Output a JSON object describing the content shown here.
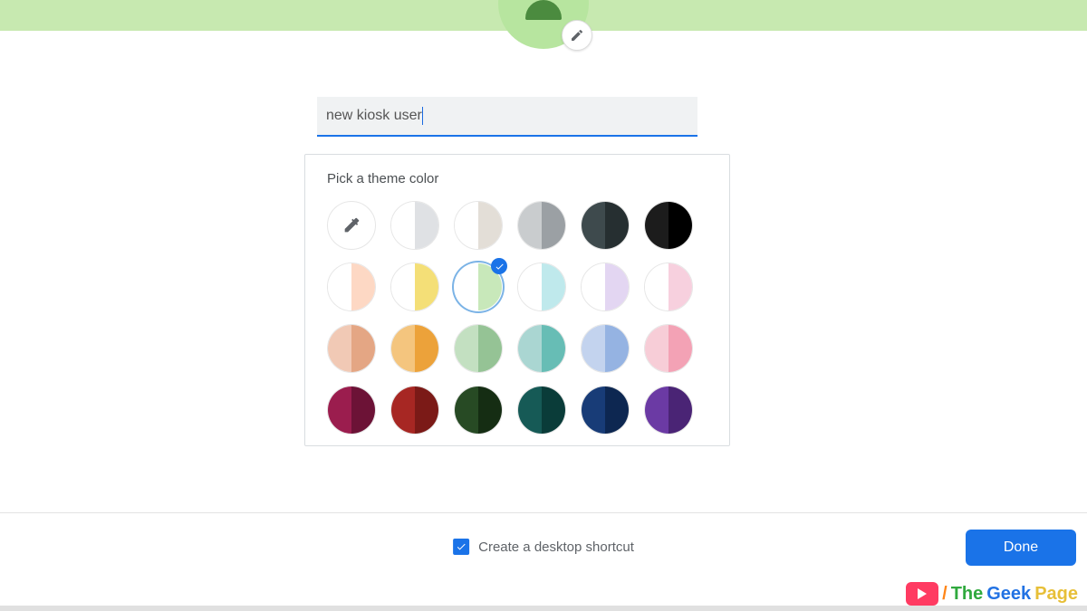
{
  "profile": {
    "name_value": "new kiosk user",
    "avatar_icon": "person-icon"
  },
  "theme_picker": {
    "title": "Pick a theme color",
    "selected_index": 8,
    "swatches": [
      {
        "kind": "eyedropper",
        "name": "custom-color",
        "left": "#ffffff",
        "right": "#ffffff"
      },
      {
        "name": "light-grey",
        "left": "#ffffff",
        "right": "#dfe1e4"
      },
      {
        "name": "warm-grey",
        "left": "#ffffff",
        "right": "#e3ded7"
      },
      {
        "name": "grey",
        "left": "#c9ccce",
        "right": "#9ba0a4"
      },
      {
        "name": "dark-slate",
        "left": "#3e4a4d",
        "right": "#262f31"
      },
      {
        "name": "black",
        "left": "#1c1c1c",
        "right": "#000000"
      },
      {
        "name": "peach-pastel",
        "left": "#ffffff",
        "right": "#fdd8c4"
      },
      {
        "name": "yellow-pastel",
        "left": "#ffffff",
        "right": "#f4df77"
      },
      {
        "name": "green-pastel",
        "left": "#ffffff",
        "right": "#c8e8ba"
      },
      {
        "name": "cyan-pastel",
        "left": "#ffffff",
        "right": "#bfe9ec"
      },
      {
        "name": "lavender-pastel",
        "left": "#ffffff",
        "right": "#e3d6f2"
      },
      {
        "name": "pink-pastel",
        "left": "#ffffff",
        "right": "#f7d0de"
      },
      {
        "name": "peach",
        "left": "#f1c9b5",
        "right": "#e4a684"
      },
      {
        "name": "orange",
        "left": "#f4c57e",
        "right": "#eca23a"
      },
      {
        "name": "green",
        "left": "#c3e0c1",
        "right": "#95c395"
      },
      {
        "name": "teal",
        "left": "#aad6d2",
        "right": "#67bdb5"
      },
      {
        "name": "blue",
        "left": "#c3d3ee",
        "right": "#95b3e2"
      },
      {
        "name": "pink",
        "left": "#f7cdd7",
        "right": "#f3a2b5"
      },
      {
        "name": "maroon",
        "left": "#9b1d4e",
        "right": "#6c1236"
      },
      {
        "name": "brick",
        "left": "#a72723",
        "right": "#7b1a17"
      },
      {
        "name": "forest",
        "left": "#274a24",
        "right": "#152d13"
      },
      {
        "name": "deep-teal",
        "left": "#165a56",
        "right": "#0a3c39"
      },
      {
        "name": "navy",
        "left": "#183c77",
        "right": "#0d2751"
      },
      {
        "name": "purple",
        "left": "#6b3aa4",
        "right": "#4a2475"
      }
    ]
  },
  "footer": {
    "shortcut_label": "Create a desktop shortcut",
    "shortcut_checked": true,
    "done_label": "Done"
  },
  "watermark": {
    "slash": "/",
    "the": "The",
    "geek": "Geek",
    "page": "Page"
  }
}
